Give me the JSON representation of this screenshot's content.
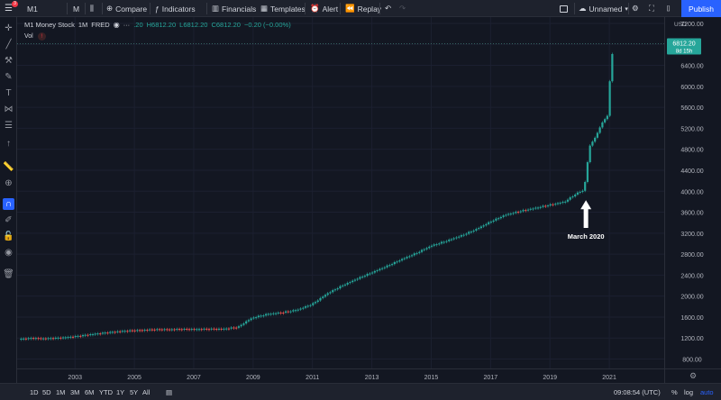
{
  "toolbar": {
    "symbol": "M1",
    "notification_count": "3",
    "interval": "M",
    "compare": "Compare",
    "indicators": "Indicators",
    "financials": "Financials",
    "templates": "Templates",
    "alert": "Alert",
    "replay": "Replay",
    "layout_name": "Unnamed",
    "publish": "Publish"
  },
  "legend": {
    "title": "M1 Money Stock",
    "interval": "1M",
    "source": "FRED",
    "open": ".20",
    "high": "H6812.20",
    "low": "L6812.20",
    "close": "C6812.20",
    "change": "−0.20 (−0.00%)",
    "volume_label": "Vol"
  },
  "price_axis": {
    "currency": "USD",
    "last_price": "6812.20",
    "countdown": "8d 15h"
  },
  "annotation": {
    "text": "March 2020",
    "color": "#ffffff"
  },
  "bottom": {
    "ranges": [
      "1D",
      "5D",
      "1M",
      "3M",
      "6M",
      "YTD",
      "1Y",
      "5Y",
      "All"
    ],
    "clock": "09:08:54 (UTC)",
    "percent": "%",
    "log": "log",
    "auto": "auto"
  },
  "colors": {
    "up": "#26a69a",
    "down": "#ef5350",
    "background": "#131722",
    "accent": "#2962ff"
  },
  "chart_data": {
    "type": "candlestick",
    "title": "M1 Money Stock",
    "y_ticks": [
      800,
      1200,
      1600,
      2000,
      2400,
      2800,
      3200,
      3600,
      4000,
      4400,
      4800,
      5200,
      5600,
      6000,
      6400,
      6800,
      7200
    ],
    "y_tick_labels": [
      "800.00",
      "1200.00",
      "1600.00",
      "2000.00",
      "2400.00",
      "2800.00",
      "3200.00",
      "3600.00",
      "4000.00",
      "4400.00",
      "4800.00",
      "5200.00",
      "5600.00",
      "6000.00",
      "6400.00",
      "6800.00",
      "7200.00"
    ],
    "ylim": [
      620,
      7320
    ],
    "x_tick_labels": [
      "2003",
      "2005",
      "2007",
      "2009",
      "2011",
      "2013",
      "2015",
      "2017",
      "2019",
      "2021"
    ],
    "x_tick_years": [
      2003,
      2005,
      2007,
      2009,
      2011,
      2013,
      2015,
      2017,
      2019,
      2021
    ],
    "xlim": [
      2001.05,
      2022.85
    ],
    "last_price": 6812.2,
    "series": [
      {
        "name": "M1 Money Stock",
        "points": [
          [
            2001.1,
            1180
          ],
          [
            2001.6,
            1200
          ],
          [
            2002.0,
            1190
          ],
          [
            2002.5,
            1205
          ],
          [
            2003.0,
            1230
          ],
          [
            2003.5,
            1270
          ],
          [
            2004.0,
            1300
          ],
          [
            2004.5,
            1330
          ],
          [
            2005.0,
            1345
          ],
          [
            2005.5,
            1360
          ],
          [
            2006.0,
            1365
          ],
          [
            2006.5,
            1368
          ],
          [
            2007.0,
            1370
          ],
          [
            2007.5,
            1372
          ],
          [
            2008.0,
            1375
          ],
          [
            2008.5,
            1410
          ],
          [
            2008.8,
            1530
          ],
          [
            2009.0,
            1590
          ],
          [
            2009.5,
            1660
          ],
          [
            2010.0,
            1690
          ],
          [
            2010.5,
            1740
          ],
          [
            2011.0,
            1850
          ],
          [
            2011.5,
            2050
          ],
          [
            2012.0,
            2200
          ],
          [
            2012.5,
            2330
          ],
          [
            2013.0,
            2450
          ],
          [
            2013.5,
            2570
          ],
          [
            2014.0,
            2700
          ],
          [
            2014.5,
            2820
          ],
          [
            2015.0,
            2960
          ],
          [
            2015.5,
            3050
          ],
          [
            2016.0,
            3150
          ],
          [
            2016.5,
            3270
          ],
          [
            2017.0,
            3420
          ],
          [
            2017.5,
            3550
          ],
          [
            2018.0,
            3620
          ],
          [
            2018.5,
            3680
          ],
          [
            2019.0,
            3740
          ],
          [
            2019.5,
            3800
          ],
          [
            2019.9,
            3960
          ],
          [
            2020.15,
            4020
          ],
          [
            2020.25,
            4490
          ],
          [
            2020.35,
            4870
          ],
          [
            2020.55,
            5050
          ],
          [
            2020.75,
            5300
          ],
          [
            2020.95,
            5450
          ],
          [
            2021.05,
            6420
          ],
          [
            2021.15,
            6812.2
          ]
        ]
      }
    ]
  }
}
